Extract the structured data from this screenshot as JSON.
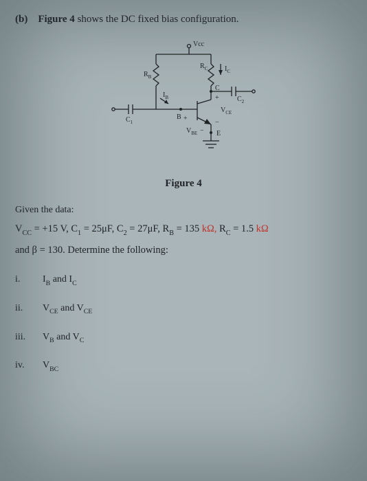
{
  "prompt": {
    "marker": "(b)",
    "figure_ref": "Figure 4",
    "tail": " shows the DC fixed bias configuration."
  },
  "circuit": {
    "Vcc": "Vcc",
    "Rb": "R",
    "Rc": "R",
    "Ic_arrow": "I",
    "C_plus": "C",
    "C1": "C",
    "C2": "C",
    "Ib": "I",
    "B": "B",
    "plus": "+",
    "Vbe": "V",
    "Vce": "V",
    "E": "E",
    "minus": "−"
  },
  "caption": "Figure 4",
  "given_heading": "Given the data:",
  "given_left": "V",
  "given_eq1": " = +15 V, C",
  "given_c1_sub": "1",
  "given_c1_val": " = 25μF, C",
  "given_c2_sub": "2",
  "given_c2_val": " = 27μF, R",
  "given_rb_sub": "B",
  "given_rb_val": " = 135 ",
  "given_rb_unit_red": "kΩ,",
  "given_rc": " R",
  "given_rc_sub": "C",
  "given_rc_val": " = 1.5 ",
  "given_rc_unit_red": "kΩ",
  "given_beta": "and β = 130. Determine the following:",
  "items": [
    {
      "num": "i.",
      "txt_a": "I",
      "txt_a_sub": "B",
      "txt_mid": " and I",
      "txt_b_sub": "C"
    },
    {
      "num": "ii.",
      "txt_a": "V",
      "txt_a_sub": "CE",
      "txt_mid": " and V",
      "txt_b_sub": "CE"
    },
    {
      "num": "iii.",
      "txt_a": "V",
      "txt_a_sub": "B",
      "txt_mid": " and V",
      "txt_b_sub": "C"
    },
    {
      "num": "iv.",
      "txt_a": "V",
      "txt_a_sub": "BC",
      "txt_mid": "",
      "txt_b_sub": ""
    }
  ]
}
